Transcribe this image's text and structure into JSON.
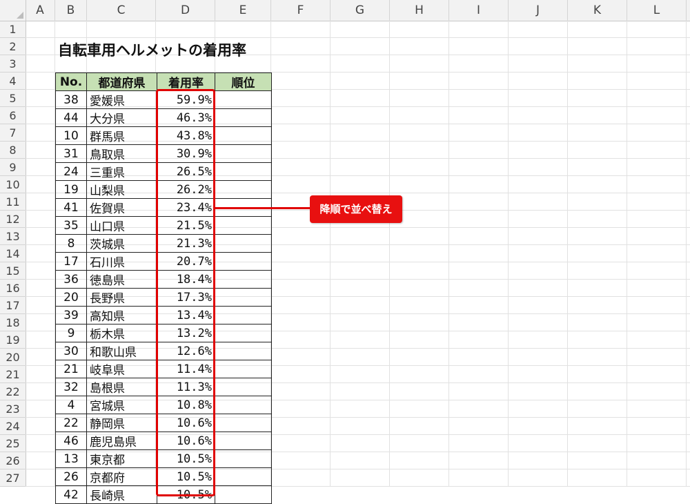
{
  "columns": [
    "A",
    "B",
    "C",
    "D",
    "E",
    "F",
    "G",
    "H",
    "I",
    "J",
    "K",
    "L"
  ],
  "rows": [
    "1",
    "2",
    "3",
    "4",
    "5",
    "6",
    "7",
    "8",
    "9",
    "10",
    "11",
    "12",
    "13",
    "14",
    "15",
    "16",
    "17",
    "18",
    "19",
    "20",
    "21",
    "22",
    "23",
    "24",
    "25",
    "26",
    "27"
  ],
  "title": "自転車用ヘルメットの着用率",
  "table": {
    "headers": {
      "no": "No.",
      "pref": "都道府県",
      "rate": "着用率",
      "rank": "順位"
    },
    "rows": [
      {
        "no": "38",
        "pref": "愛媛県",
        "rate": "59.9%"
      },
      {
        "no": "44",
        "pref": "大分県",
        "rate": "46.3%"
      },
      {
        "no": "10",
        "pref": "群馬県",
        "rate": "43.8%"
      },
      {
        "no": "31",
        "pref": "鳥取県",
        "rate": "30.9%"
      },
      {
        "no": "24",
        "pref": "三重県",
        "rate": "26.5%"
      },
      {
        "no": "19",
        "pref": "山梨県",
        "rate": "26.2%"
      },
      {
        "no": "41",
        "pref": "佐賀県",
        "rate": "23.4%"
      },
      {
        "no": "35",
        "pref": "山口県",
        "rate": "21.5%"
      },
      {
        "no": "8",
        "pref": "茨城県",
        "rate": "21.3%"
      },
      {
        "no": "17",
        "pref": "石川県",
        "rate": "20.7%"
      },
      {
        "no": "36",
        "pref": "徳島県",
        "rate": "18.4%"
      },
      {
        "no": "20",
        "pref": "長野県",
        "rate": "17.3%"
      },
      {
        "no": "39",
        "pref": "高知県",
        "rate": "13.4%"
      },
      {
        "no": "9",
        "pref": "栃木県",
        "rate": "13.2%"
      },
      {
        "no": "30",
        "pref": "和歌山県",
        "rate": "12.6%"
      },
      {
        "no": "21",
        "pref": "岐阜県",
        "rate": "11.4%"
      },
      {
        "no": "32",
        "pref": "島根県",
        "rate": "11.3%"
      },
      {
        "no": "4",
        "pref": "宮城県",
        "rate": "10.8%"
      },
      {
        "no": "22",
        "pref": "静岡県",
        "rate": "10.6%"
      },
      {
        "no": "46",
        "pref": "鹿児島県",
        "rate": "10.6%"
      },
      {
        "no": "13",
        "pref": "東京都",
        "rate": "10.5%"
      },
      {
        "no": "26",
        "pref": "京都府",
        "rate": "10.5%"
      },
      {
        "no": "42",
        "pref": "長崎県",
        "rate": "10.5%"
      }
    ]
  },
  "callout": {
    "text": "降順で並べ替え"
  },
  "colors": {
    "header_fill": "#c6e0b4",
    "highlight": "#e00000",
    "callout_bg": "#e81010"
  }
}
